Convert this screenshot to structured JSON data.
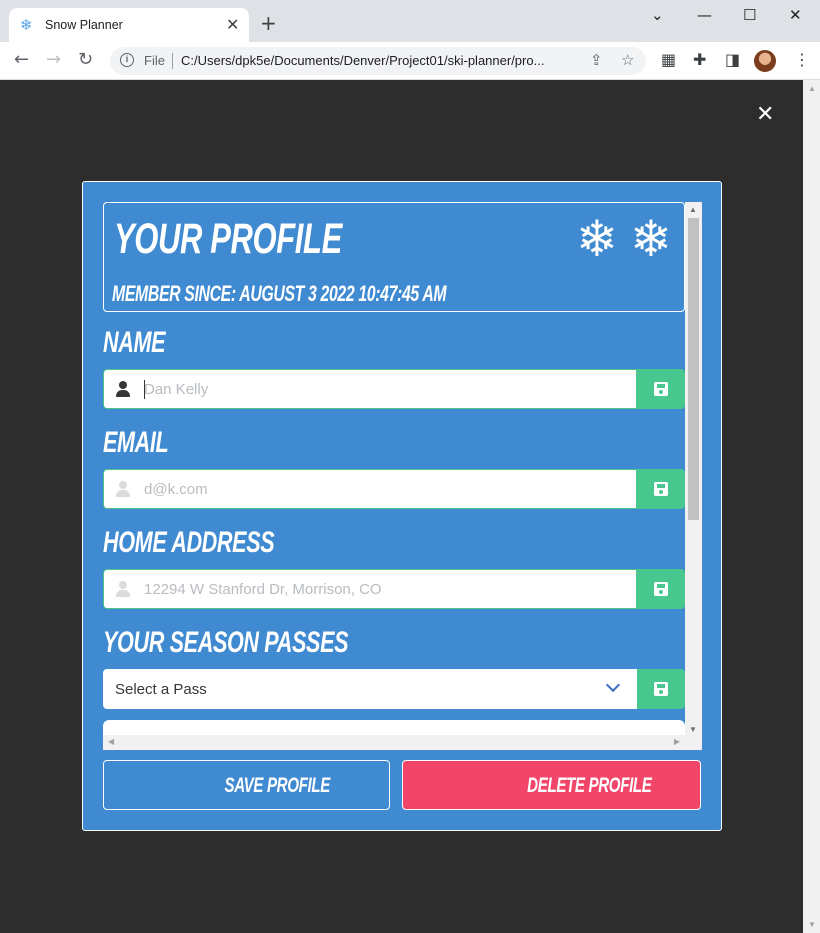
{
  "browser": {
    "tab_title": "Snow Planner",
    "tab_icon": "❄",
    "file_label": "File",
    "url": "C:/Users/dpk5e/Documents/Denver/Project01/ski-planner/pro..."
  },
  "modal": {
    "title": "Your Profile",
    "member_since": "Member Since: August 3 2022 10:47:45 AM",
    "snowflakes": "❄❄",
    "fields": {
      "name": {
        "label": "Name",
        "value": "Dan Kelly"
      },
      "email": {
        "label": "Email",
        "value": "d@k.com"
      },
      "address": {
        "label": "Home Address",
        "value": "12294 W Stanford Dr, Morrison, CO"
      },
      "passes": {
        "label": "Your Season Passes",
        "value": "Select a Pass"
      }
    },
    "save_profile": "Save Profile",
    "delete_profile": "Delete Profile"
  },
  "colors": {
    "page_background": "#2d2d2d",
    "modal_background": "#3f8ad0",
    "save_green": "#48c78e",
    "delete_pink": "#f1466a"
  }
}
